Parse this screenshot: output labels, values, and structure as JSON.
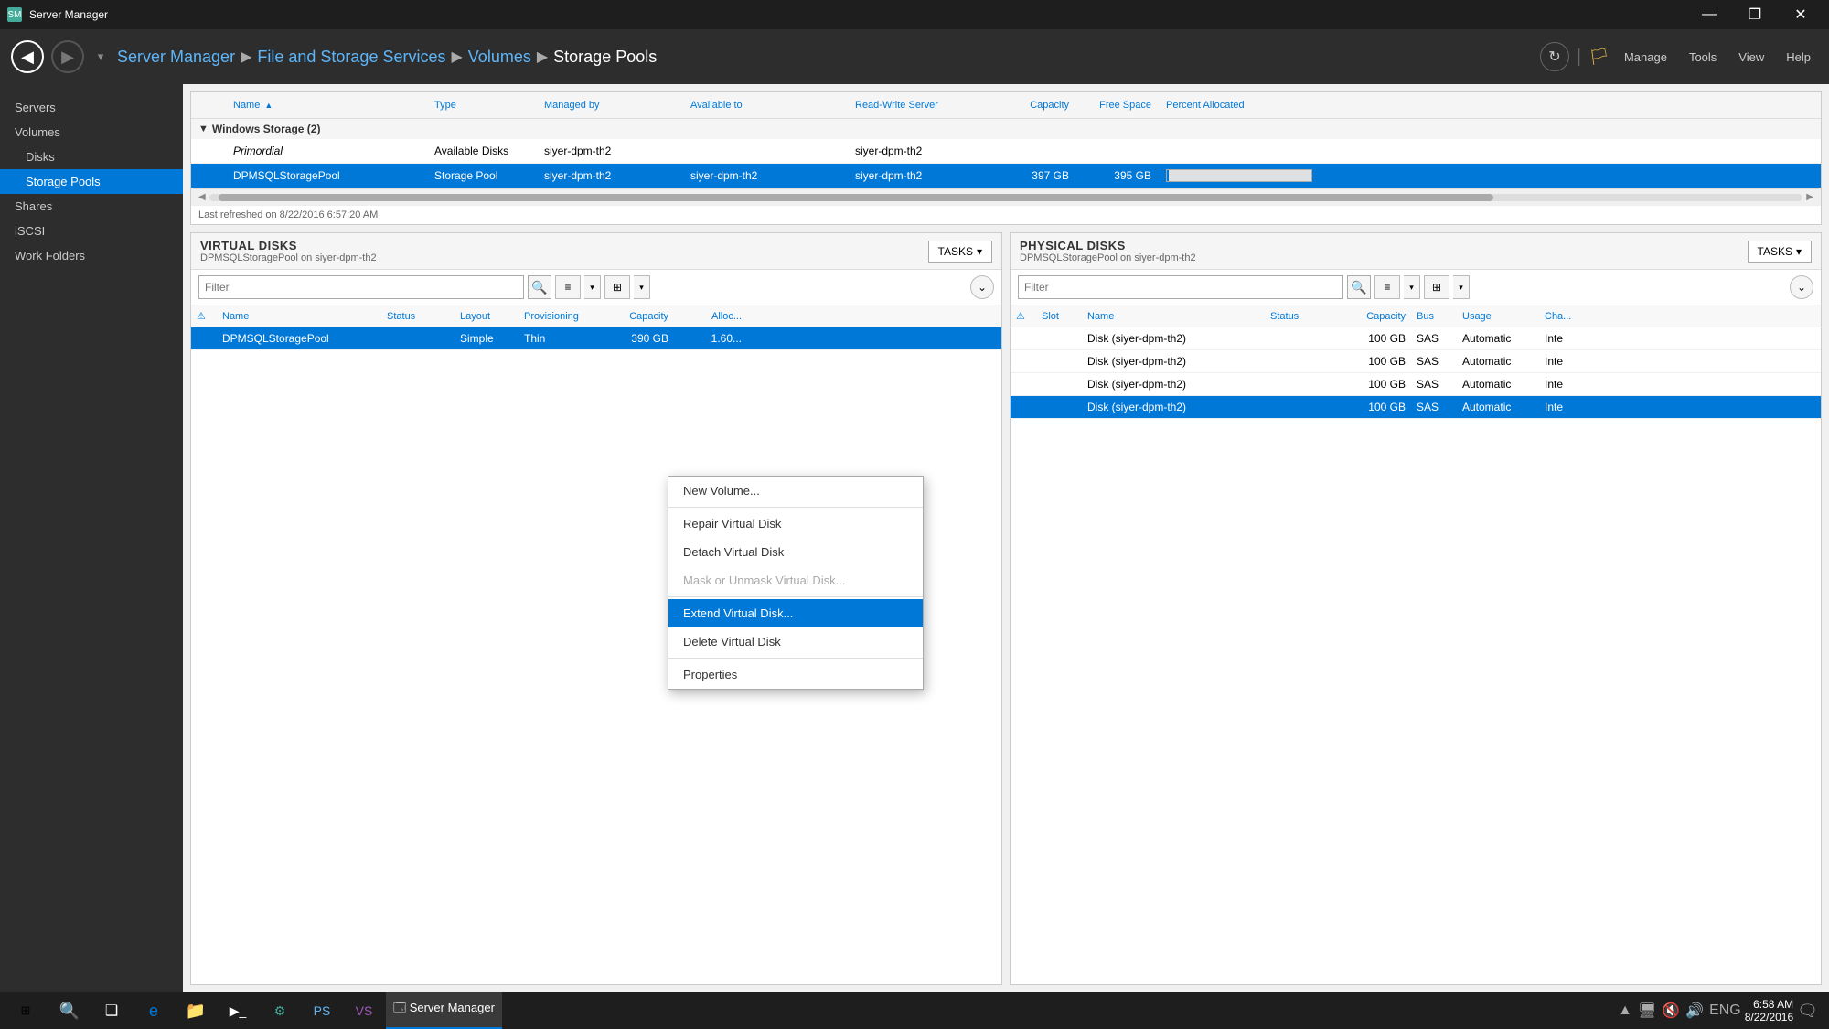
{
  "window": {
    "title": "Server Manager",
    "icon": "SM"
  },
  "titlebar": {
    "minimize": "—",
    "maximize": "❐",
    "close": "✕"
  },
  "navbar": {
    "back": "◀",
    "forward": "▶",
    "breadcrumb": [
      {
        "label": "Server Manager",
        "link": false
      },
      {
        "label": "File and Storage Services",
        "link": true
      },
      {
        "label": "Volumes",
        "link": true
      },
      {
        "label": "Storage Pools",
        "link": false
      }
    ],
    "refresh": "↻",
    "manage": "Manage",
    "tools": "Tools",
    "view": "View",
    "help": "Help"
  },
  "sidebar": {
    "items": [
      {
        "label": "Servers",
        "active": false,
        "indented": false
      },
      {
        "label": "Volumes",
        "active": false,
        "indented": false
      },
      {
        "label": "Disks",
        "active": false,
        "indented": true
      },
      {
        "label": "Storage Pools",
        "active": true,
        "indented": true
      },
      {
        "label": "Shares",
        "active": false,
        "indented": false
      },
      {
        "label": "iSCSI",
        "active": false,
        "indented": false
      },
      {
        "label": "Work Folders",
        "active": false,
        "indented": false
      }
    ]
  },
  "storage_table": {
    "section": "Windows Storage (2)",
    "columns": [
      "Name",
      "Type",
      "Managed by",
      "Available to",
      "Read-Write Server",
      "Capacity",
      "Free Space",
      "Percent Allocated"
    ],
    "rows": [
      {
        "warning": false,
        "name": "Primordial",
        "type": "Available Disks",
        "managed_by": "siyer-dpm-th2",
        "available_to": "",
        "rw_server": "siyer-dpm-th2",
        "capacity": "",
        "free_space": "",
        "percent": ""
      },
      {
        "warning": false,
        "name": "DPMSQLStoragePool",
        "type": "Storage Pool",
        "managed_by": "siyer-dpm-th2",
        "available_to": "siyer-dpm-th2",
        "rw_server": "siyer-dpm-th2",
        "capacity": "397 GB",
        "free_space": "395 GB",
        "percent": "1%",
        "selected": true
      }
    ],
    "refresh_text": "Last refreshed on 8/22/2016 6:57:20 AM"
  },
  "virtual_disks": {
    "label": "VIRTUAL DISKS",
    "sublabel": "DPMSQLStoragePool on siyer-dpm-th2",
    "tasks_label": "TASKS",
    "filter_placeholder": "Filter",
    "columns": [
      "Name",
      "Status",
      "Layout",
      "Provisioning",
      "Capacity",
      "Alloc..."
    ],
    "rows": [
      {
        "warning": false,
        "name": "DPMSQLStoragePool",
        "status": "",
        "layout": "Simple",
        "provisioning": "Thin",
        "capacity": "390 GB",
        "alloc": "1.60...",
        "selected": true
      }
    ]
  },
  "physical_disks": {
    "label": "PHYSICAL DISKS",
    "sublabel": "DPMSQLStoragePool on siyer-dpm-th2",
    "tasks_label": "TASKS",
    "filter_placeholder": "Filter",
    "columns": [
      "Slot",
      "Name",
      "Status",
      "Capacity",
      "Bus",
      "Usage",
      "Cha..."
    ],
    "rows": [
      {
        "warning": false,
        "slot": "",
        "name": "Disk (siyer-dpm-th2)",
        "status": "",
        "capacity": "100 GB",
        "bus": "SAS",
        "usage": "Automatic",
        "chassis": "Inte"
      },
      {
        "warning": false,
        "slot": "",
        "name": "Disk (siyer-dpm-th2)",
        "status": "",
        "capacity": "100 GB",
        "bus": "SAS",
        "usage": "Automatic",
        "chassis": "Inte"
      },
      {
        "warning": false,
        "slot": "",
        "name": "Disk (siyer-dpm-th2)",
        "status": "",
        "capacity": "100 GB",
        "bus": "SAS",
        "usage": "Automatic",
        "chassis": "Inte"
      },
      {
        "warning": false,
        "slot": "",
        "name": "Disk (siyer-dpm-th2)",
        "status": "",
        "capacity": "100 GB",
        "bus": "SAS",
        "usage": "Automatic",
        "chassis": "Inte",
        "selected": true
      }
    ]
  },
  "context_menu": {
    "items": [
      {
        "label": "New Volume...",
        "disabled": false,
        "highlighted": false,
        "separator_after": false
      },
      {
        "label": "Repair Virtual Disk",
        "disabled": false,
        "highlighted": false,
        "separator_after": false
      },
      {
        "label": "Detach Virtual Disk",
        "disabled": false,
        "highlighted": false,
        "separator_after": false
      },
      {
        "label": "Mask or Unmask Virtual Disk...",
        "disabled": true,
        "highlighted": false,
        "separator_after": true
      },
      {
        "label": "Extend Virtual Disk...",
        "disabled": false,
        "highlighted": true,
        "separator_after": false
      },
      {
        "label": "Delete Virtual Disk",
        "disabled": false,
        "highlighted": false,
        "separator_after": true
      },
      {
        "label": "Properties",
        "disabled": false,
        "highlighted": false,
        "separator_after": false
      }
    ]
  },
  "taskbar": {
    "start_icon": "⊞",
    "search_icon": "⚲",
    "task_view": "❑",
    "time": "6:58 AM",
    "date": "8/22/2016",
    "eng": "ENG",
    "apps": [
      {
        "icon": "🗔",
        "active": true
      }
    ]
  }
}
